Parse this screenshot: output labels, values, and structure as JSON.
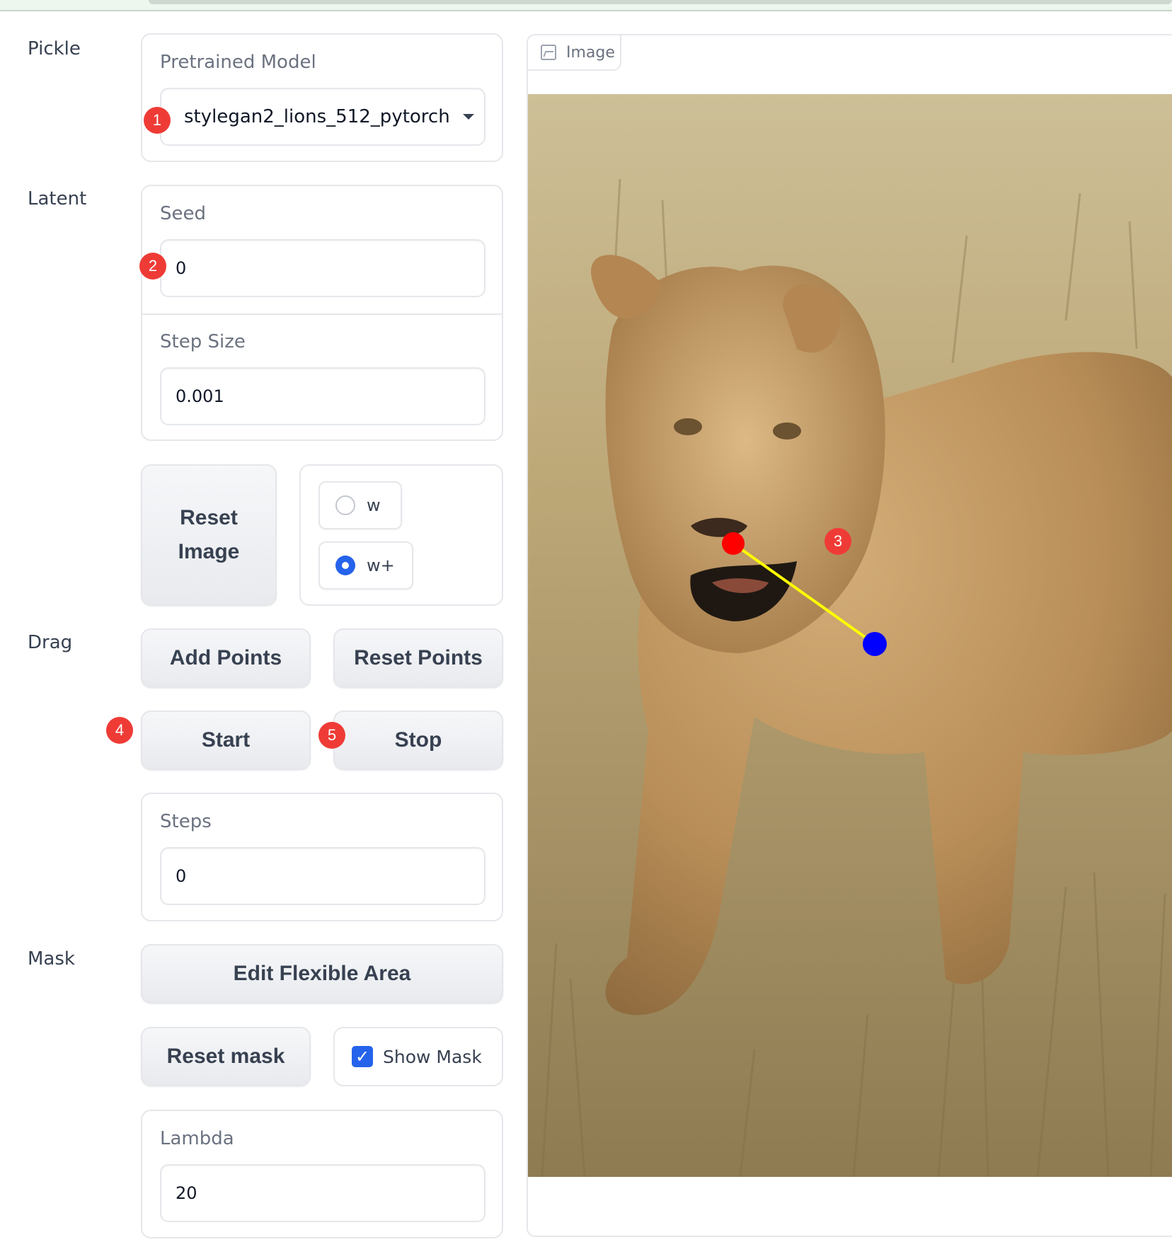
{
  "sections": {
    "pickle": "Pickle",
    "latent": "Latent",
    "drag": "Drag",
    "mask": "Mask"
  },
  "pickle": {
    "label": "Pretrained Model",
    "value": "stylegan2_lions_512_pytorch"
  },
  "latent": {
    "seed_label": "Seed",
    "seed_value": "0",
    "step_label": "Step Size",
    "step_value": "0.001",
    "reset_button": "Reset Image",
    "radio_options": [
      "w",
      "w+"
    ],
    "radio_selected": "w+"
  },
  "drag": {
    "add_points": "Add Points",
    "reset_points": "Reset Points",
    "start": "Start",
    "stop": "Stop",
    "steps_label": "Steps",
    "steps_value": "0"
  },
  "mask": {
    "edit_area": "Edit Flexible Area",
    "reset_mask": "Reset mask",
    "show_mask_label": "Show Mask",
    "show_mask_checked": true,
    "lambda_label": "Lambda",
    "lambda_value": "20"
  },
  "image_panel": {
    "tab_label": "Image",
    "image_icon": "image-icon"
  },
  "annotations": [
    "1",
    "2",
    "3",
    "4",
    "5"
  ],
  "colors": {
    "accent": "#2563eb",
    "badge": "#ef3b36",
    "handle_point": "#ff0000",
    "target_point": "#0000ff",
    "drag_line": "#ffff00"
  }
}
